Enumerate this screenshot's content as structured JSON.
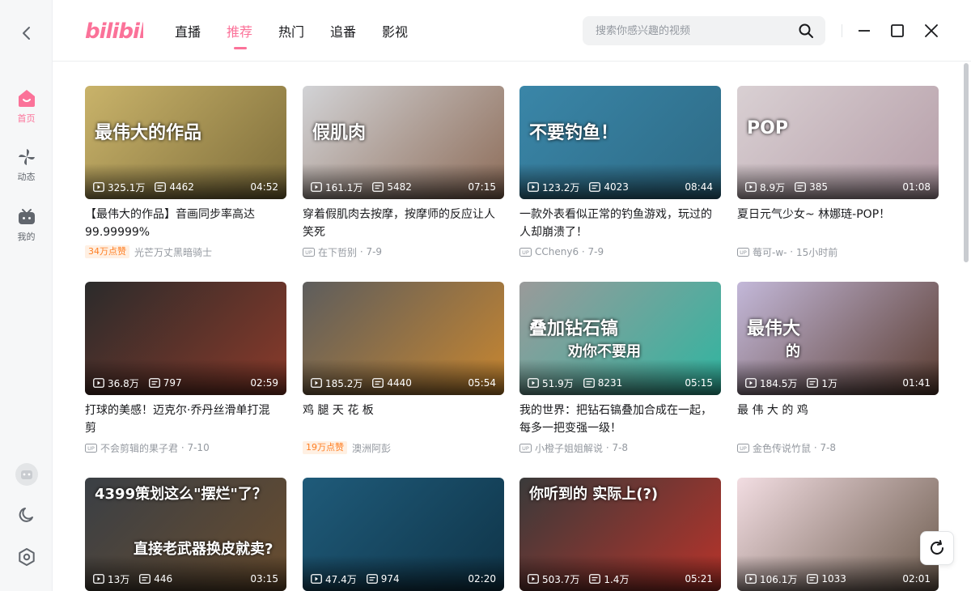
{
  "app": {
    "logo_text": "bilibili",
    "brand_color": "#fb7299"
  },
  "sidebar": {
    "items": [
      {
        "label": "首页",
        "icon": "home-icon",
        "active": true
      },
      {
        "label": "动态",
        "icon": "pinwheel-icon",
        "active": false
      },
      {
        "label": "我的",
        "icon": "tv-icon",
        "active": false
      }
    ],
    "bottom_icons": [
      "avatar-icon",
      "moon-icon",
      "settings-icon"
    ]
  },
  "header": {
    "tabs": [
      {
        "label": "直播",
        "active": false
      },
      {
        "label": "推荐",
        "active": true
      },
      {
        "label": "热门",
        "active": false
      },
      {
        "label": "追番",
        "active": false
      },
      {
        "label": "影视",
        "active": false
      }
    ],
    "search": {
      "placeholder": "搜索你感兴趣的视频",
      "value": ""
    }
  },
  "feed": {
    "cards": [
      {
        "views": "325.1万",
        "danmaku": "4462",
        "duration": "04:52",
        "title": "【最伟大的作品】音画同步率高达99.99999%",
        "badge": "34万点赞",
        "author": "光芒万丈黑暗骑士",
        "date": "",
        "overlay_text": "最伟大的作品",
        "colors": [
          "#c9b36a",
          "#7e6d3a"
        ]
      },
      {
        "views": "161.1万",
        "danmaku": "5482",
        "duration": "07:15",
        "title": "穿着假肌肉去按摩，按摩师的反应让人笑死",
        "badge": "",
        "author": "在下哲别",
        "date": "7-9",
        "overlay_text": "假肌肉",
        "colors": [
          "#d2d3d6",
          "#8d6c58"
        ]
      },
      {
        "views": "123.2万",
        "danmaku": "4023",
        "duration": "08:44",
        "title": "一款外表看似正常的钓鱼游戏，玩过的人却崩溃了！",
        "badge": "",
        "author": "CCheny6",
        "date": "7-9",
        "overlay_text": "不要钓鱼！",
        "colors": [
          "#3a86a8",
          "#2d6a85"
        ]
      },
      {
        "views": "8.9万",
        "danmaku": "385",
        "duration": "01:08",
        "title": "夏日元气少女~ 林娜琏-POP！",
        "badge": "",
        "author": "莓可-w-",
        "date": "15小时前",
        "overlay_text": "POP",
        "colors": [
          "#d9d0d3",
          "#b59da7"
        ]
      },
      {
        "views": "36.8万",
        "danmaku": "797",
        "duration": "02:59",
        "title": "打球的美感！迈克尔·乔丹丝滑单打混剪",
        "badge": "",
        "author": "不会剪辑的果子君",
        "date": "7-10",
        "overlay_text": "",
        "colors": [
          "#2b2b2b",
          "#8b3a2a"
        ]
      },
      {
        "views": "185.2万",
        "danmaku": "4440",
        "duration": "05:54",
        "title": "鸡 腿 天 花 板",
        "badge": "19万点赞",
        "author": "澳洲阿彭",
        "date": "",
        "overlay_text": "",
        "colors": [
          "#5d5d5d",
          "#c8862f"
        ]
      },
      {
        "views": "51.9万",
        "danmaku": "8231",
        "duration": "05:15",
        "title": "我的世界：把钻石镐叠加合成在一起，每多一把变强一级！",
        "badge": "",
        "author": "小橙子姐姐解说",
        "date": "7-8",
        "overlay_text": "叠加钻石镐",
        "overlay_text2": "劝你不要用",
        "colors": [
          "#9a9a9a",
          "#2fb5a0"
        ]
      },
      {
        "views": "184.5万",
        "danmaku": "1万",
        "duration": "01:41",
        "title": "最 伟 大 的 鸡",
        "badge": "",
        "author": "金色传说竹鼠",
        "date": "7-8",
        "overlay_text": "最伟大",
        "overlay_text2": "的",
        "colors": [
          "#c3b8d9",
          "#5a3c30"
        ]
      },
      {
        "views": "13万",
        "danmaku": "446",
        "duration": "03:15",
        "title": "",
        "badge": "",
        "author": "",
        "date": "",
        "overlay_text": "4399策划这么\"摆烂\"了？",
        "overlay_text2": "直接老武器换皮就卖?",
        "colors": [
          "#3a3f45",
          "#6a4d2e"
        ]
      },
      {
        "views": "47.4万",
        "danmaku": "974",
        "duration": "02:20",
        "title": "",
        "badge": "",
        "author": "",
        "date": "",
        "overlay_text": "",
        "colors": [
          "#1f5b7a",
          "#0f3448"
        ]
      },
      {
        "views": "503.7万",
        "danmaku": "1.4万",
        "duration": "05:21",
        "title": "",
        "badge": "",
        "author": "",
        "date": "",
        "overlay_text": "你听到的  实际上(?)",
        "colors": [
          "#3a3a3a",
          "#b8332a"
        ]
      },
      {
        "views": "106.1万",
        "danmaku": "1033",
        "duration": "02:01",
        "title": "",
        "badge": "",
        "author": "",
        "date": "",
        "overlay_text": "",
        "colors": [
          "#f2dde2",
          "#6b5a4c"
        ]
      }
    ]
  }
}
